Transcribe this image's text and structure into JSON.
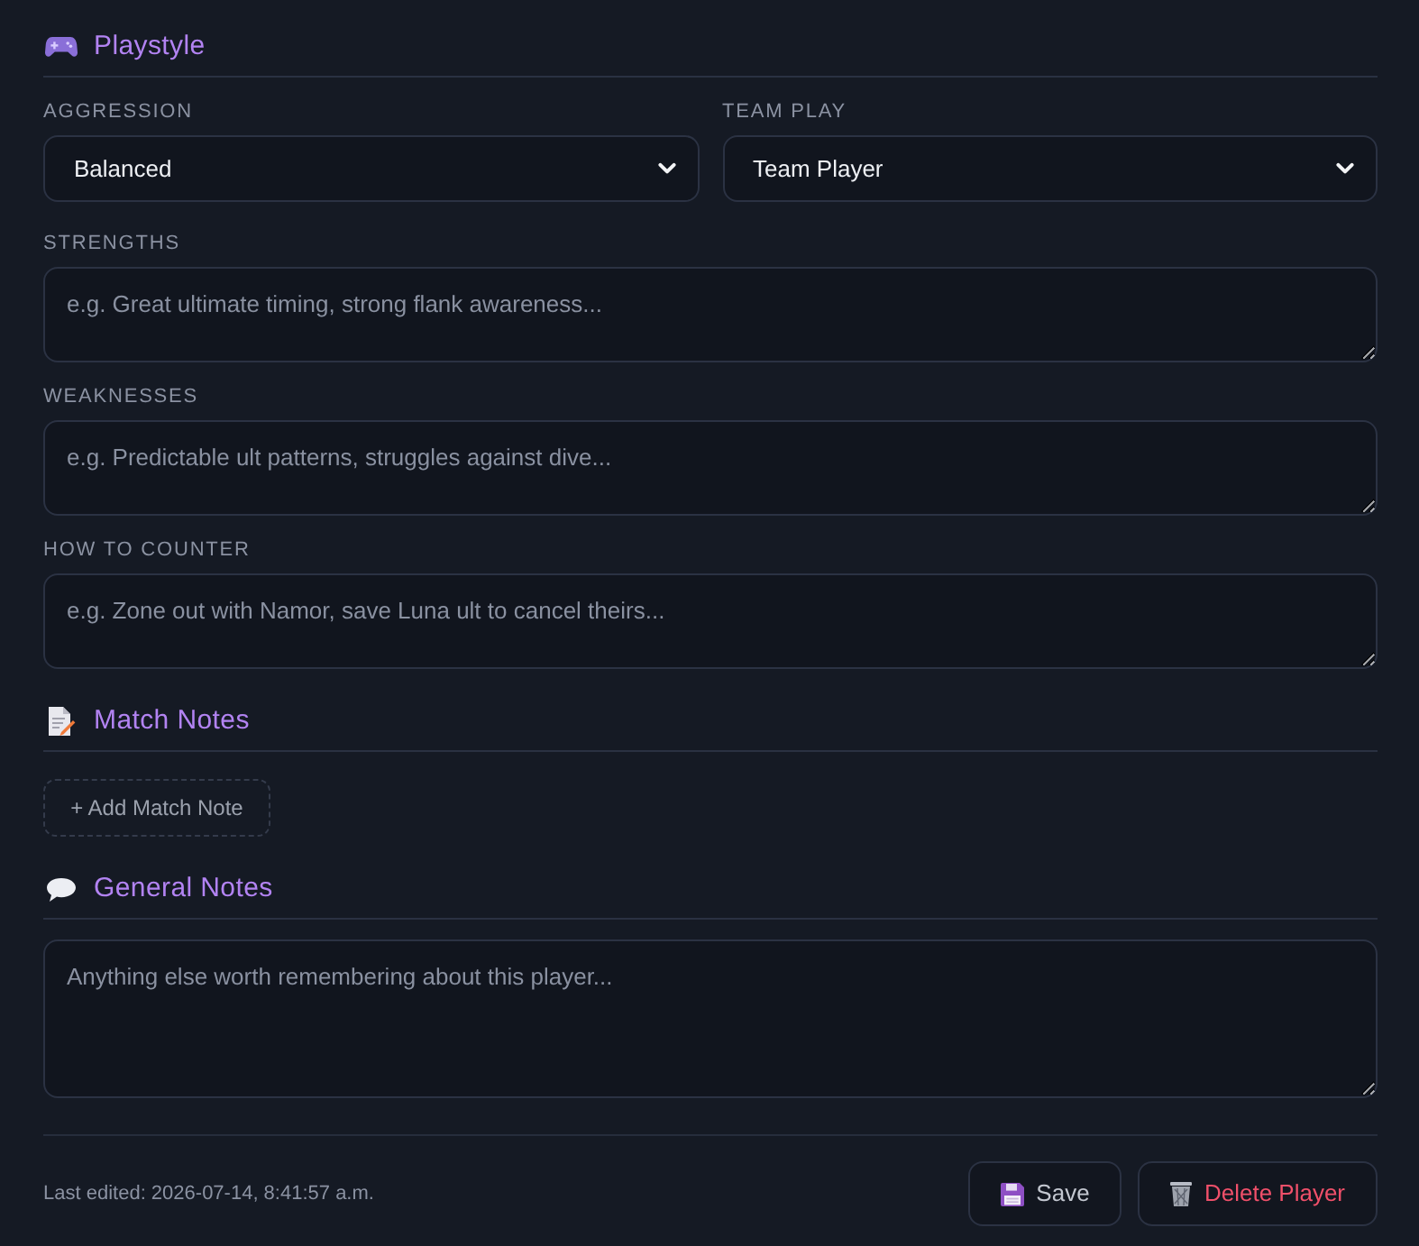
{
  "playstyle": {
    "title": "Playstyle",
    "selects": [
      {
        "label": "AGGRESSION",
        "value": "Balanced"
      },
      {
        "label": "TEAM PLAY",
        "value": "Team Player"
      }
    ],
    "text_fields": [
      {
        "label": "STRENGTHS",
        "placeholder": "e.g. Great ultimate timing, strong flank awareness..."
      },
      {
        "label": "WEAKNESSES",
        "placeholder": "e.g. Predictable ult patterns, struggles against dive..."
      },
      {
        "label": "HOW TO COUNTER",
        "placeholder": "e.g. Zone out with Namor, save Luna ult to cancel theirs..."
      }
    ]
  },
  "match_notes": {
    "title": "Match Notes",
    "add_button": "+ Add Match Note"
  },
  "general_notes": {
    "title": "General Notes",
    "placeholder": "Anything else worth remembering about this player..."
  },
  "footer": {
    "last_edited": "Last edited: 2026-07-14, 8:41:57 a.m.",
    "buttons": [
      {
        "kind": "save",
        "label": "Save"
      },
      {
        "kind": "delete",
        "label": "Delete Player"
      }
    ]
  }
}
